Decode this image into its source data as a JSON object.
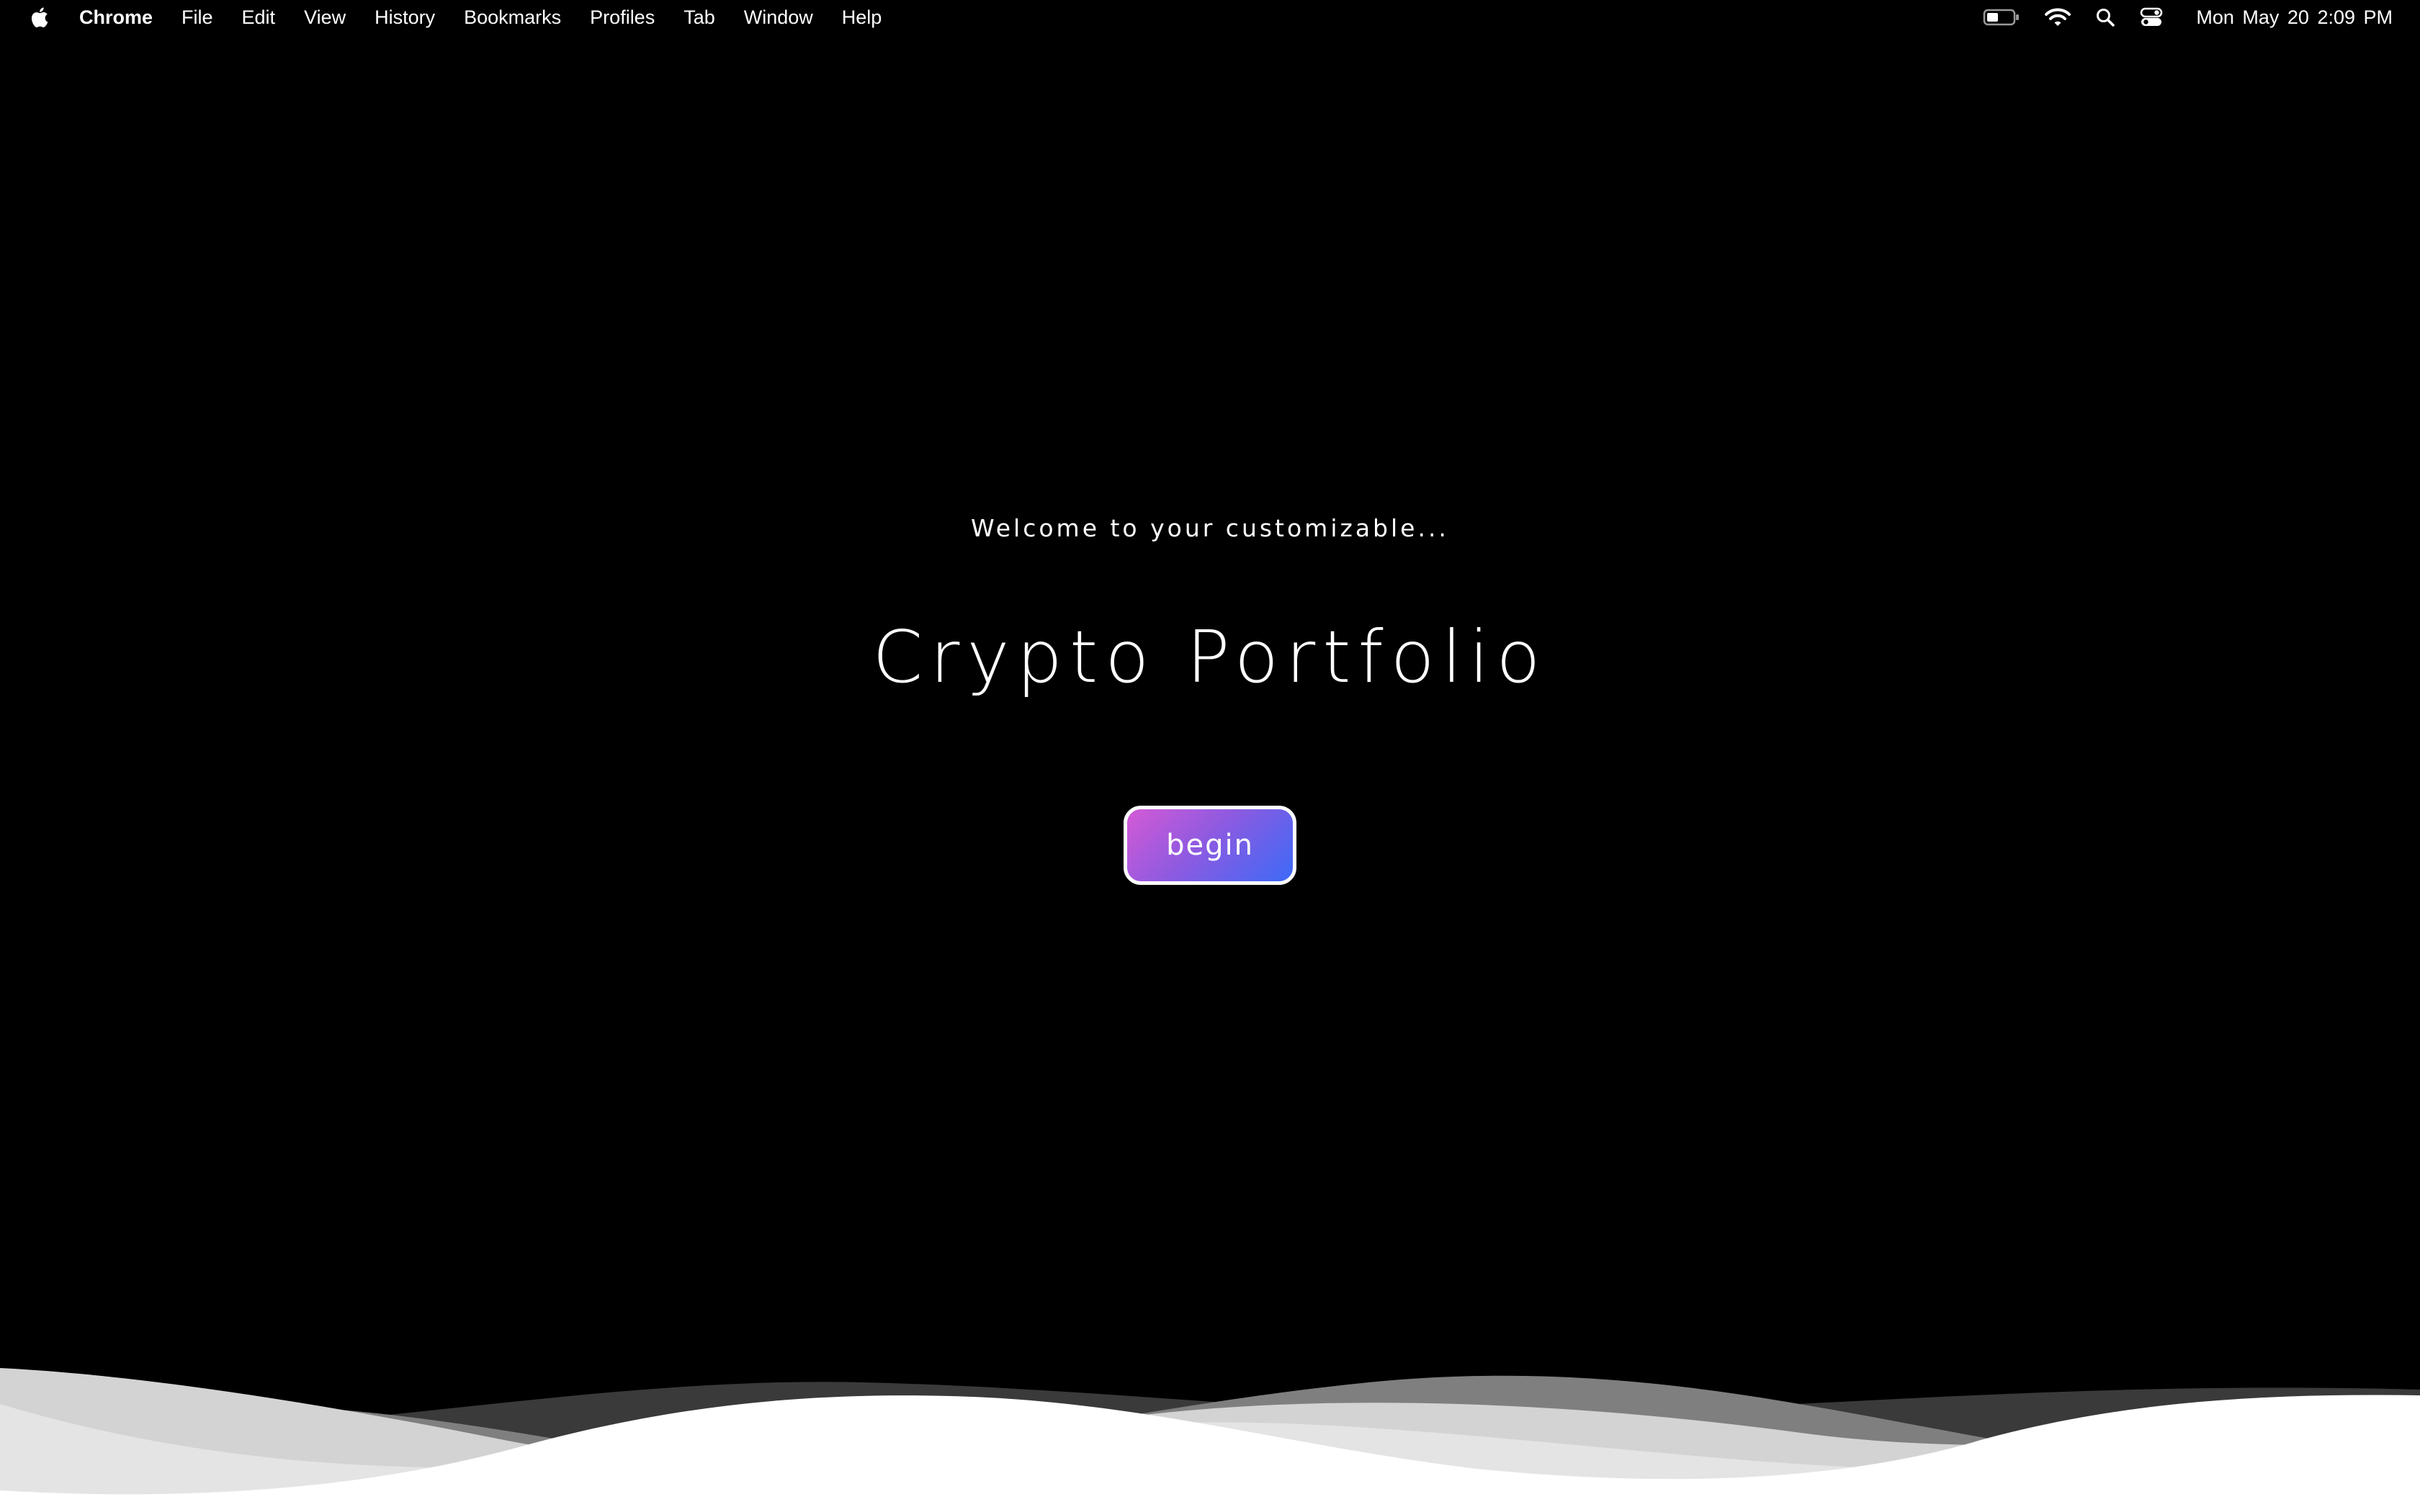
{
  "menubar": {
    "app_name": "Chrome",
    "items": [
      "File",
      "Edit",
      "View",
      "History",
      "Bookmarks",
      "Profiles",
      "Tab",
      "Window",
      "Help"
    ],
    "clock": "Mon May 20  2:09 PM",
    "icons": [
      "apple-logo",
      "battery-icon",
      "wifi-icon",
      "spotlight-search-icon",
      "control-center-icon"
    ]
  },
  "hero": {
    "subtitle": "Welcome to your customizable...",
    "title": "Crypto Portfolio",
    "button_label": "begin"
  },
  "colors": {
    "background": "#000000",
    "button_gradient_start": "#d45ad6",
    "button_gradient_end": "#3c6af7",
    "wave_front": "#ffffff",
    "wave_light": "#d9d9d9",
    "wave_mid": "#808080",
    "wave_dark": "#3a3a3a"
  }
}
